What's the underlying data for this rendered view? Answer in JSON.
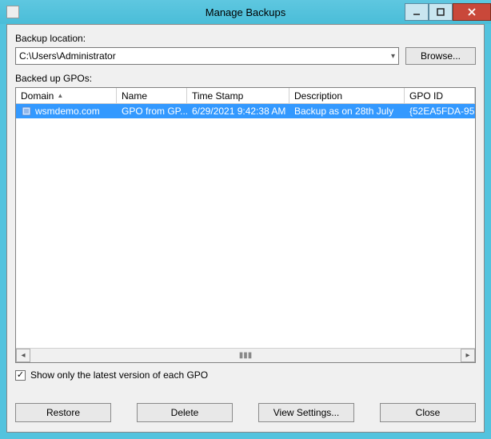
{
  "window": {
    "title": "Manage Backups"
  },
  "location": {
    "label": "Backup location:",
    "value": "C:\\Users\\Administrator",
    "browse": "Browse..."
  },
  "list": {
    "label": "Backed up GPOs:",
    "columns": {
      "domain": "Domain",
      "name": "Name",
      "time": "Time Stamp",
      "desc": "Description",
      "gpoid": "GPO ID"
    },
    "rows": [
      {
        "domain": "wsmdemo.com",
        "name": "GPO from GP...",
        "time": "6/29/2021 9:42:38 AM",
        "desc": "Backup as on 28th July",
        "gpoid": "{52EA5FDA-95...",
        "selected": true
      }
    ]
  },
  "checkbox": {
    "checked": true,
    "label": "Show only the latest version of each GPO"
  },
  "buttons": {
    "restore": "Restore",
    "delete": "Delete",
    "view": "View Settings...",
    "close": "Close"
  }
}
